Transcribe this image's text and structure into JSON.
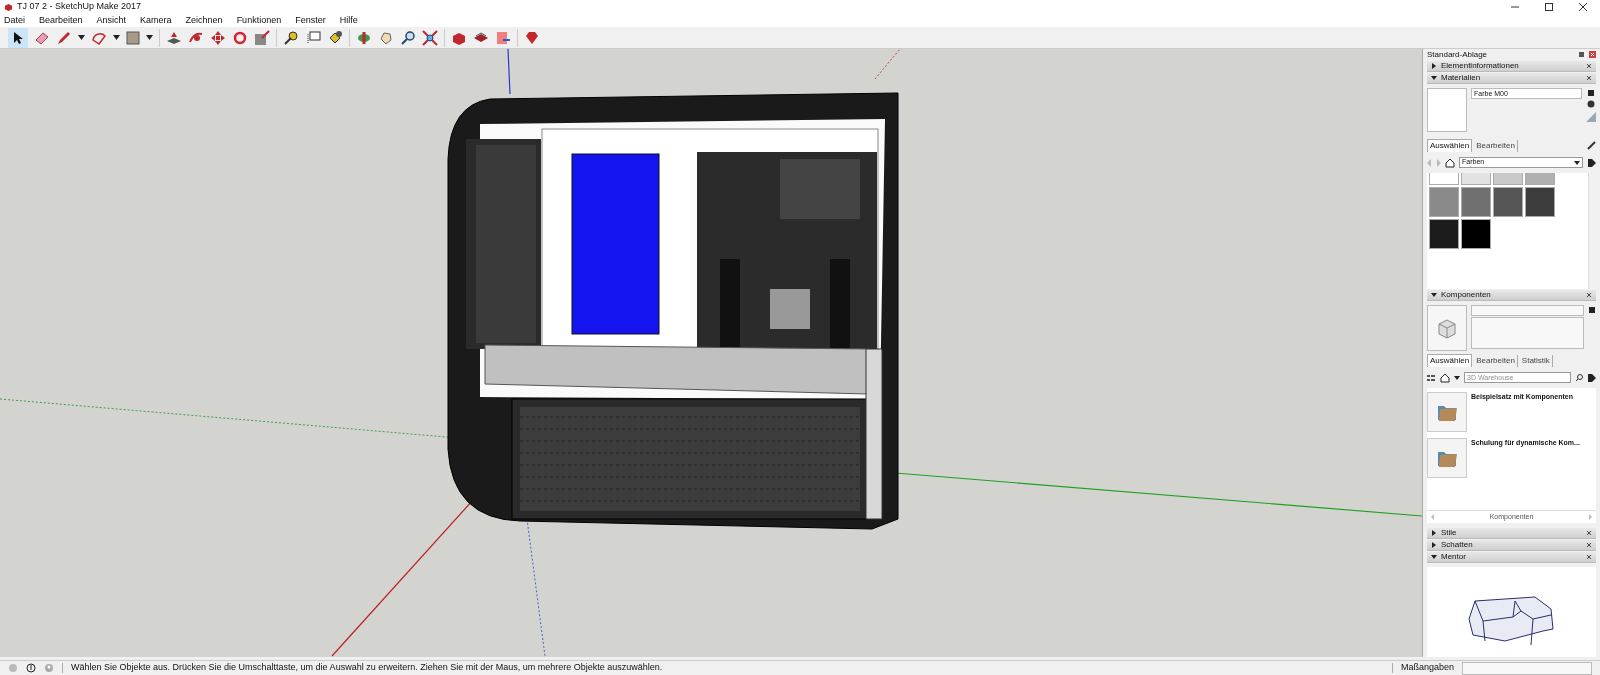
{
  "window": {
    "title": "TJ 07 2 - SketchUp Make 2017"
  },
  "menu": [
    "Datei",
    "Bearbeiten",
    "Ansicht",
    "Kamera",
    "Zeichnen",
    "Funktionen",
    "Fenster",
    "Hilfe"
  ],
  "tray": {
    "title": "Standard-Ablage",
    "sections": [
      {
        "title": "Elementinformationen",
        "expanded": false
      },
      {
        "kind": "materials",
        "title": "Materialien",
        "expanded": true,
        "material_name": "Farbe M00",
        "tabs": [
          {
            "label": "Auswählen",
            "selected": true
          },
          {
            "label": "Bearbeiten",
            "selected": false
          }
        ],
        "library": "Farben",
        "swatches": [
          {
            "color": "#ffffff"
          },
          {
            "color": "#e2e2e2"
          },
          {
            "color": "#c8c8c8"
          },
          {
            "color": "#b0b0b0"
          },
          {
            "color": "#8a8a8a"
          },
          {
            "color": "#707070"
          },
          {
            "color": "#555555"
          },
          {
            "color": "#3c3c3c"
          },
          {
            "color": "#1c1c1c"
          },
          {
            "color": "#000000"
          }
        ]
      },
      {
        "kind": "components",
        "title": "Komponenten",
        "expanded": true,
        "tabs": [
          {
            "label": "Auswählen",
            "selected": true
          },
          {
            "label": "Bearbeiten",
            "selected": false
          },
          {
            "label": "Statistik",
            "selected": false
          }
        ],
        "search": {
          "placeholder": "3D Warehouse"
        },
        "items": [
          {
            "title": "Beispielsatz mit Komponenten"
          },
          {
            "title": "Schulung für dynamische Kom..."
          }
        ],
        "footer": "Komponenten"
      },
      {
        "title": "Stile",
        "expanded": false
      },
      {
        "title": "Schatten",
        "expanded": false
      },
      {
        "kind": "mentor",
        "title": "Mentor",
        "expanded": true
      }
    ]
  },
  "status_bar": {
    "text": "Wählen Sie Objekte aus. Drücken Sie die Umschalttaste, um die Auswahl zu erweitern. Ziehen Sie mit der Maus, um mehrere Objekte auszuwählen.",
    "measurements_label": "Maßangaben"
  }
}
